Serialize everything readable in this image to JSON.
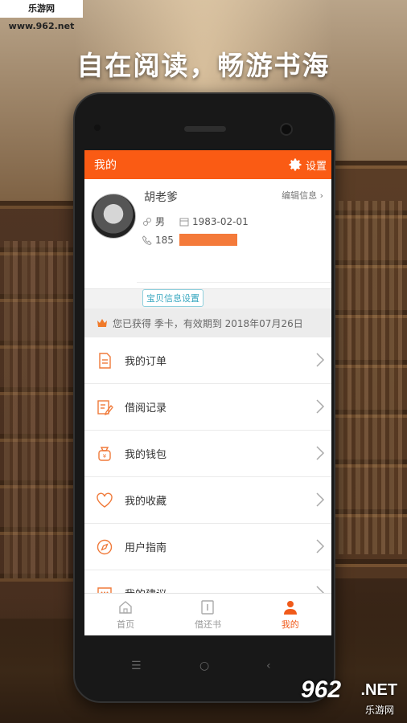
{
  "watermark_top": "乐游网 www.962.net",
  "headline": "自在阅读，畅游书海",
  "header": {
    "title": "我的",
    "settings_label": "设置"
  },
  "profile": {
    "name": "胡老爹",
    "edit_label": "编辑信息",
    "gender": "男",
    "birthday": "1983-02-01",
    "phone_prefix": "185",
    "baby_settings": "宝贝信息设置"
  },
  "vip_text": "您已获得 季卡，有效期到 2018年07月26日",
  "menu": [
    {
      "label": "我的订单",
      "icon": "order-doc-icon"
    },
    {
      "label": "借阅记录",
      "icon": "borrow-record-icon"
    },
    {
      "label": "我的钱包",
      "icon": "wallet-bag-icon"
    },
    {
      "label": "我的收藏",
      "icon": "heart-icon"
    },
    {
      "label": "用户指南",
      "icon": "compass-icon"
    },
    {
      "label": "我的建议",
      "icon": "chat-bubble-icon"
    }
  ],
  "tabs": [
    {
      "label": "首页",
      "icon": "home-icon"
    },
    {
      "label": "借还书",
      "icon": "book-exchange-icon"
    },
    {
      "label": "我的",
      "icon": "user-icon",
      "active": true
    }
  ],
  "watermark_bottom": {
    "num": "962",
    "net": ".NET",
    "cn": "乐游网"
  },
  "colors": {
    "accent": "#fa5b14",
    "menu_icon": "#f07a3a",
    "badge_border": "#8fd0dd"
  }
}
